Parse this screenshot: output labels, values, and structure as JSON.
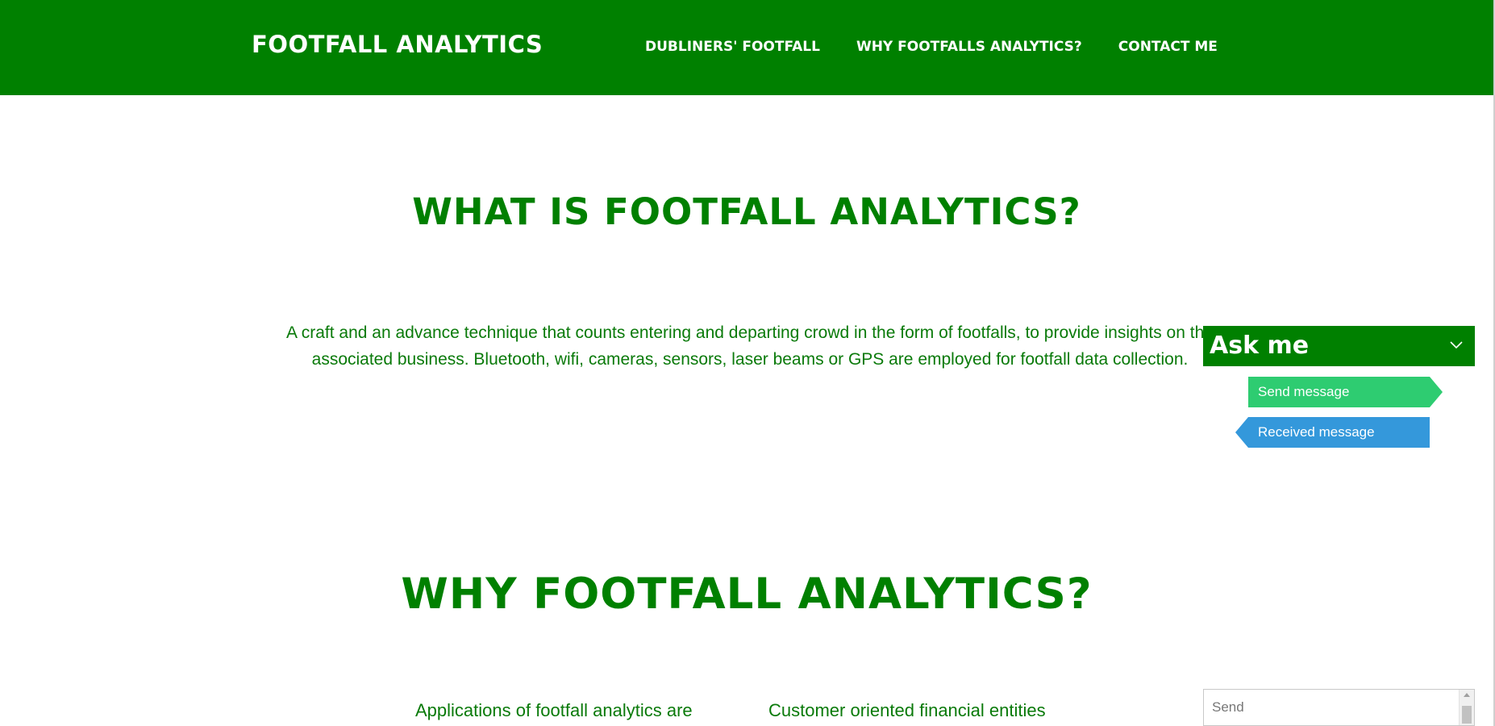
{
  "navbar": {
    "brand": "FOOTFALL ANALYTICS",
    "links": [
      {
        "label": "DUBLINERS' FOOTFALL"
      },
      {
        "label": "WHY FOOTFALLS ANALYTICS?"
      },
      {
        "label": "CONTACT ME"
      }
    ],
    "background_color": "#008000"
  },
  "what_section": {
    "heading": "WHAT IS FOOTFALL ANALYTICS?",
    "description": "A craft and an advance technique that counts entering and departing crowd in the form of footfalls, to provide insights on the associated business. Bluetooth, wifi, cameras, sensors, laser beams or GPS are employed for footfall data collection."
  },
  "why_section": {
    "heading": "WHY FOOTFALL ANALYTICS?",
    "column_left_text": "Applications of footfall analytics are",
    "column_right_text": "Customer oriented financial entities"
  },
  "chat_widget": {
    "title": "Ask me",
    "toggle_icon": "chevron-down-icon",
    "sent_message": "Send message",
    "received_message": "Received message",
    "input_placeholder": "Send",
    "sent_color": "#2ecc71",
    "received_color": "#3498db",
    "header_color": "#008000"
  },
  "colors": {
    "accent": "#008000",
    "text_green": "#0a7a0a"
  }
}
